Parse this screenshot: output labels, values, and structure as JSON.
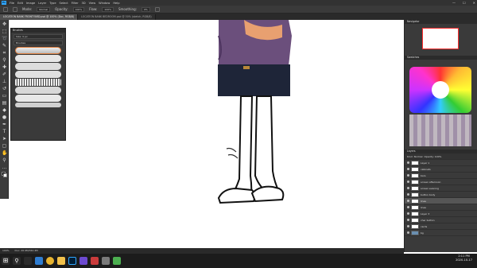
{
  "app": {
    "menu": [
      "File",
      "Edit",
      "Image",
      "Layer",
      "Type",
      "Select",
      "Filter",
      "3D",
      "View",
      "Window",
      "Help"
    ],
    "window_controls": [
      "—",
      "☐",
      "✕"
    ]
  },
  "options_bar": {
    "mode_label": "Mode:",
    "mode_value": "Normal",
    "opacity_label": "Opacity:",
    "opacity_value": "100%",
    "flow_label": "Flow:",
    "flow_value": "100%",
    "smoothing_label": "Smoothing:",
    "smoothing_value": "0%"
  },
  "tabs": [
    {
      "label": "LOCATION BANK FRONTYARD.psd @ 100% (Doc, RGB/8)",
      "active": true
    },
    {
      "label": "LOCATION BANK BEDROOM.psd @ 50% (sketch, RGB/8)",
      "active": false
    }
  ],
  "brush_panel": {
    "title": "Brushes",
    "size_label": "Size:",
    "size_value": "9 px",
    "folder_label": "Brushes"
  },
  "right_dock": {
    "navigator_title": "Navigator",
    "swatches_title": "Swatches",
    "layers_title": "Layers",
    "layer_kind": "Kind",
    "blend_mode": "Normal",
    "opacity": "Opacity: 100%",
    "fill": "Fill: 100%",
    "layers": [
      {
        "name": "Layer 1",
        "selected": false
      },
      {
        "name": "cabinets",
        "selected": false
      },
      {
        "name": "bars",
        "selected": false
      },
      {
        "name": "screen afternoon",
        "selected": false
      },
      {
        "name": "screen evening",
        "selected": false
      },
      {
        "name": "button body",
        "selected": false
      },
      {
        "name": "lines",
        "selected": true
      },
      {
        "name": "lines",
        "selected": false
      },
      {
        "name": "Layer 3",
        "selected": false
      },
      {
        "name": "char button",
        "selected": false
      },
      {
        "name": "cards",
        "selected": false
      },
      {
        "name": "bg",
        "selected": false
      }
    ]
  },
  "status_bar": {
    "zoom": "100%",
    "doc": "Doc: 26.9M/342.4M"
  },
  "taskbar": {
    "time": "2:11 PM",
    "date": "2020-10-17"
  },
  "colors": {
    "accent": "#31a8ff",
    "panel": "#3a3a3a",
    "workspace": "#ffffff"
  }
}
